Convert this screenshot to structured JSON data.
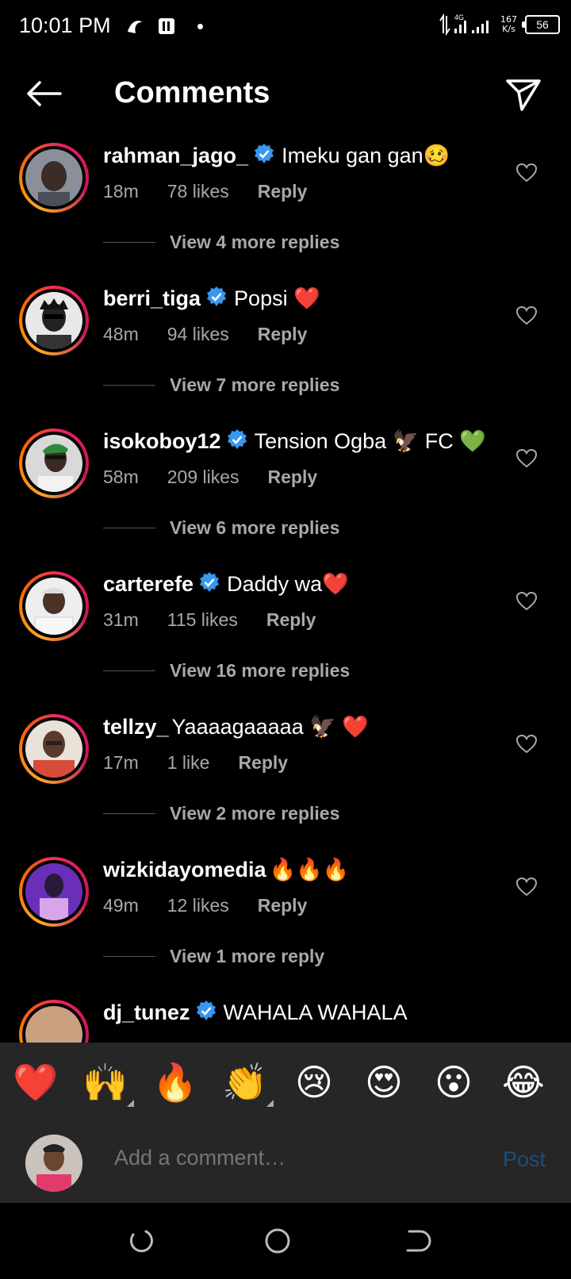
{
  "status_bar": {
    "time": "10:01 PM",
    "network": "4G",
    "speed_value": "167",
    "speed_unit": "K/s",
    "battery": "56"
  },
  "header": {
    "title": "Comments"
  },
  "comments": [
    {
      "username": "rahman_jago_",
      "verified": true,
      "text": "Imeku gan gan🥴",
      "time": "18m",
      "likes": "78 likes",
      "reply": "Reply",
      "view_replies": "View 4 more replies",
      "avatar_color": "#8a8f9a"
    },
    {
      "username": "berri_tiga",
      "verified": true,
      "text": "Popsi ❤️",
      "time": "48m",
      "likes": "94 likes",
      "reply": "Reply",
      "view_replies": "View 7 more replies",
      "avatar_color": "#e8e8e8"
    },
    {
      "username": "isokoboy12",
      "verified": true,
      "text": "Tension Ogba 🦅 FC 💚",
      "time": "58m",
      "likes": "209 likes",
      "reply": "Reply",
      "view_replies": "View 6 more replies",
      "avatar_color": "#d9d9d9"
    },
    {
      "username": "carterefe",
      "verified": true,
      "text": "Daddy wa❤️",
      "time": "31m",
      "likes": "115 likes",
      "reply": "Reply",
      "view_replies": "View 16 more replies",
      "avatar_color": "#eeeeee"
    },
    {
      "username": "tellzy_",
      "verified": false,
      "text": "Yaaaagaaaaa 🦅 ❤️",
      "time": "17m",
      "likes": "1 like",
      "reply": "Reply",
      "view_replies": "View 2 more replies",
      "avatar_color": "#d84a3a"
    },
    {
      "username": "wizkidayomedia",
      "verified": false,
      "text": "🔥🔥🔥",
      "time": "49m",
      "likes": "12 likes",
      "reply": "Reply",
      "view_replies": "View 1 more reply",
      "avatar_color": "#6a2fb8"
    },
    {
      "username": "dj_tunez",
      "verified": true,
      "text": "WAHALA WAHALA",
      "time": "",
      "likes": "",
      "reply": "",
      "view_replies": "",
      "avatar_color": "#c9a080"
    }
  ],
  "emoji_bar": [
    "❤️",
    "🙌",
    "🔥",
    "👏",
    "😢",
    "😍",
    "😮",
    "😂"
  ],
  "comment_input": {
    "placeholder": "Add a comment…",
    "post_label": "Post"
  },
  "colors": {
    "background": "#000000",
    "secondary_text": "#a8a8a8",
    "verified_blue": "#3897f0",
    "post_disabled": "#1e4d78",
    "bar_background": "#262626"
  }
}
